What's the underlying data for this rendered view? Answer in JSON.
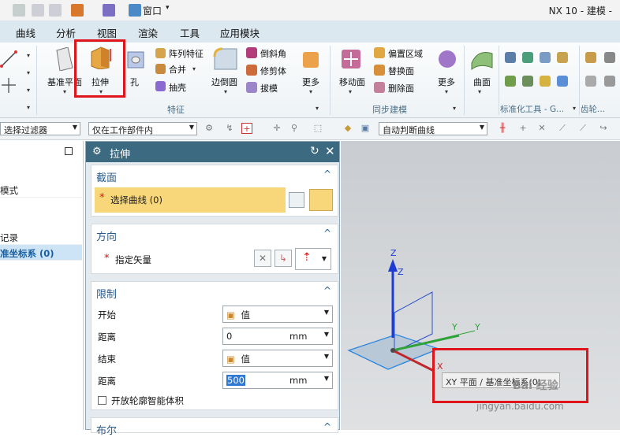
{
  "window": {
    "title": "NX 10 - 建模 -",
    "window_menu": "窗口"
  },
  "menu_tabs": [
    "曲线",
    "分析",
    "视图",
    "渲染",
    "工具",
    "应用模块"
  ],
  "ribbon": {
    "datum_plane": "基准平面",
    "extrude": "拉伸",
    "hole": "孔",
    "pattern_feature": "阵列特征",
    "unite": "合并",
    "shell": "抽壳",
    "edge_blend": "边倒圆",
    "chamfer": "倒斜角",
    "trim_body": "修剪体",
    "draft": "拔模",
    "more1": "更多",
    "move_face": "移动面",
    "offset_region": "偏置区域",
    "replace_face": "替换面",
    "delete_face": "删除面",
    "more2": "更多",
    "surface": "曲面",
    "group_feature": "特征",
    "group_sync": "同步建模",
    "group_std": "标准化工具 - G...",
    "group_gear": "齿轮..."
  },
  "filterbar": {
    "filter": "选择过滤器",
    "scope": "仅在工作部件内",
    "curve_rule": "自动判断曲线"
  },
  "navigator": {
    "rows": [
      "模式",
      "记录",
      "准坐标系 (0)"
    ]
  },
  "dialog": {
    "title": "拉伸",
    "section": {
      "header": "截面",
      "select_curve": "选择曲线 (0)"
    },
    "direction": {
      "header": "方向",
      "specify_vector": "指定矢量"
    },
    "limits": {
      "header": "限制",
      "start_label": "开始",
      "start_value": "值",
      "start_dist_label": "距离",
      "start_dist": "0",
      "start_unit": "mm",
      "end_label": "结束",
      "end_value": "值",
      "end_dist_label": "距离",
      "end_dist": "500",
      "end_unit": "mm",
      "open_profile": "开放轮廓智能体积"
    },
    "boolean": {
      "header": "布尔"
    }
  },
  "viewport": {
    "axis_z": "Z",
    "axis_y": "Y",
    "axis_x": "X",
    "tooltip": "XY 平面 / 基准坐标系(0)",
    "watermark": "jingyan.baidu.com",
    "watermark_brand": "Bai 经验"
  },
  "colors": {
    "highlight_red": "#e0141b",
    "dialog_header": "#3c6a80",
    "selection_yellow": "#f8d77a"
  }
}
